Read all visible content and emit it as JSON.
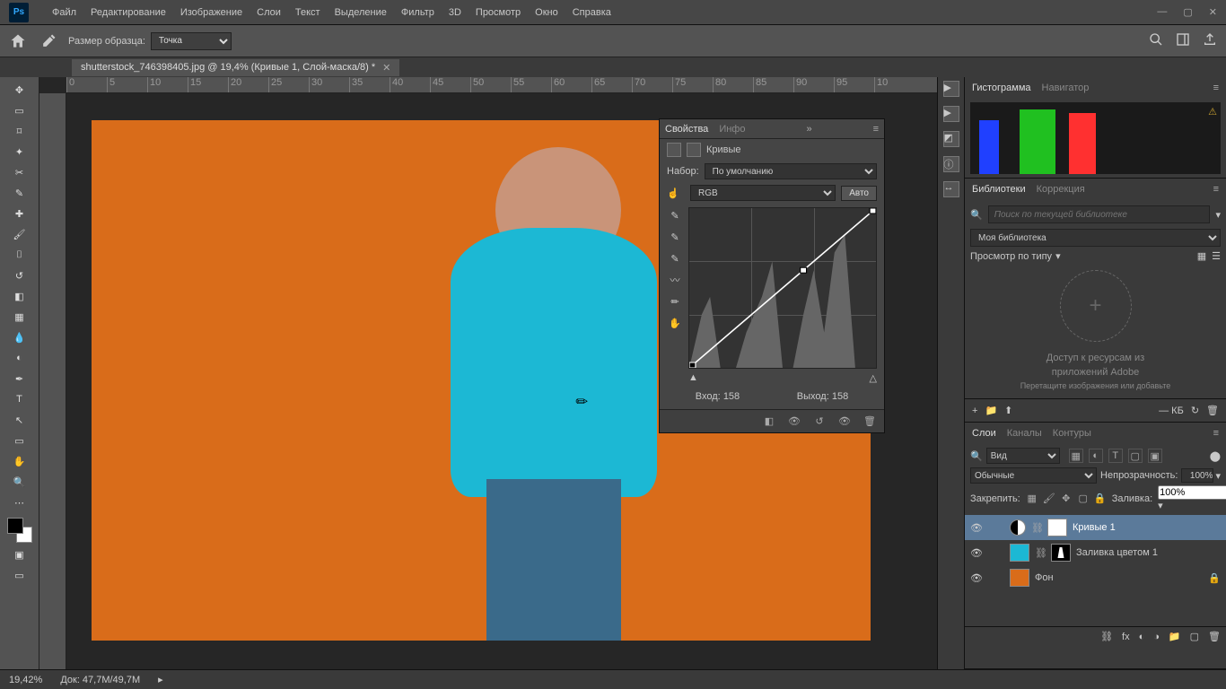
{
  "menu": {
    "items": [
      "Файл",
      "Редактирование",
      "Изображение",
      "Слои",
      "Текст",
      "Выделение",
      "Фильтр",
      "3D",
      "Просмотр",
      "Окно",
      "Справка"
    ]
  },
  "options_bar": {
    "sample_size_label": "Размер образца:",
    "sample_size_value": "Точка"
  },
  "document_tab": "shutterstock_746398405.jpg @ 19,4% (Кривые 1, Слой-маска/8) *",
  "ruler_ticks": [
    "0",
    "5",
    "10",
    "15",
    "20",
    "25",
    "30",
    "35",
    "40",
    "45",
    "50",
    "55",
    "60",
    "65",
    "70",
    "75",
    "80",
    "85",
    "90",
    "95",
    "10"
  ],
  "properties": {
    "tab_props": "Свойства",
    "tab_info": "Инфо",
    "adjustment_title": "Кривые",
    "nabor_label": "Набор:",
    "nabor_value": "По умолчанию",
    "channel_value": "RGB",
    "auto_label": "Авто",
    "input_label": "Вход:",
    "input_value": "158",
    "output_label": "Выход:",
    "output_value": "158"
  },
  "right": {
    "hist_tab": "Гистограмма",
    "nav_tab": "Навигатор",
    "lib_tab": "Библиотеки",
    "corr_tab": "Коррекция",
    "lib_search_placeholder": "Поиск по текущей библиотеке",
    "lib_select": "Моя библиотека",
    "lib_viewby": "Просмотр по типу",
    "lib_cta1": "Доступ к ресурсам из",
    "lib_cta2": "приложений Adobe",
    "lib_hint": "Перетащите изображения или добавьте",
    "lib_kb": "— КБ",
    "layers_tab": "Слои",
    "channels_tab": "Каналы",
    "paths_tab": "Контуры",
    "layer_kind": "Вид",
    "blend_mode": "Обычные",
    "opacity_label": "Непрозрачность:",
    "opacity_value": "100%",
    "lock_label": "Закрепить:",
    "fill_label": "Заливка:",
    "fill_value": "100%",
    "layer1_name": "Кривые 1",
    "layer2_name": "Заливка цветом 1",
    "layer3_name": "Фон"
  },
  "status": {
    "zoom": "19,42%",
    "doc_info": "Док: 47,7M/49,7M"
  }
}
